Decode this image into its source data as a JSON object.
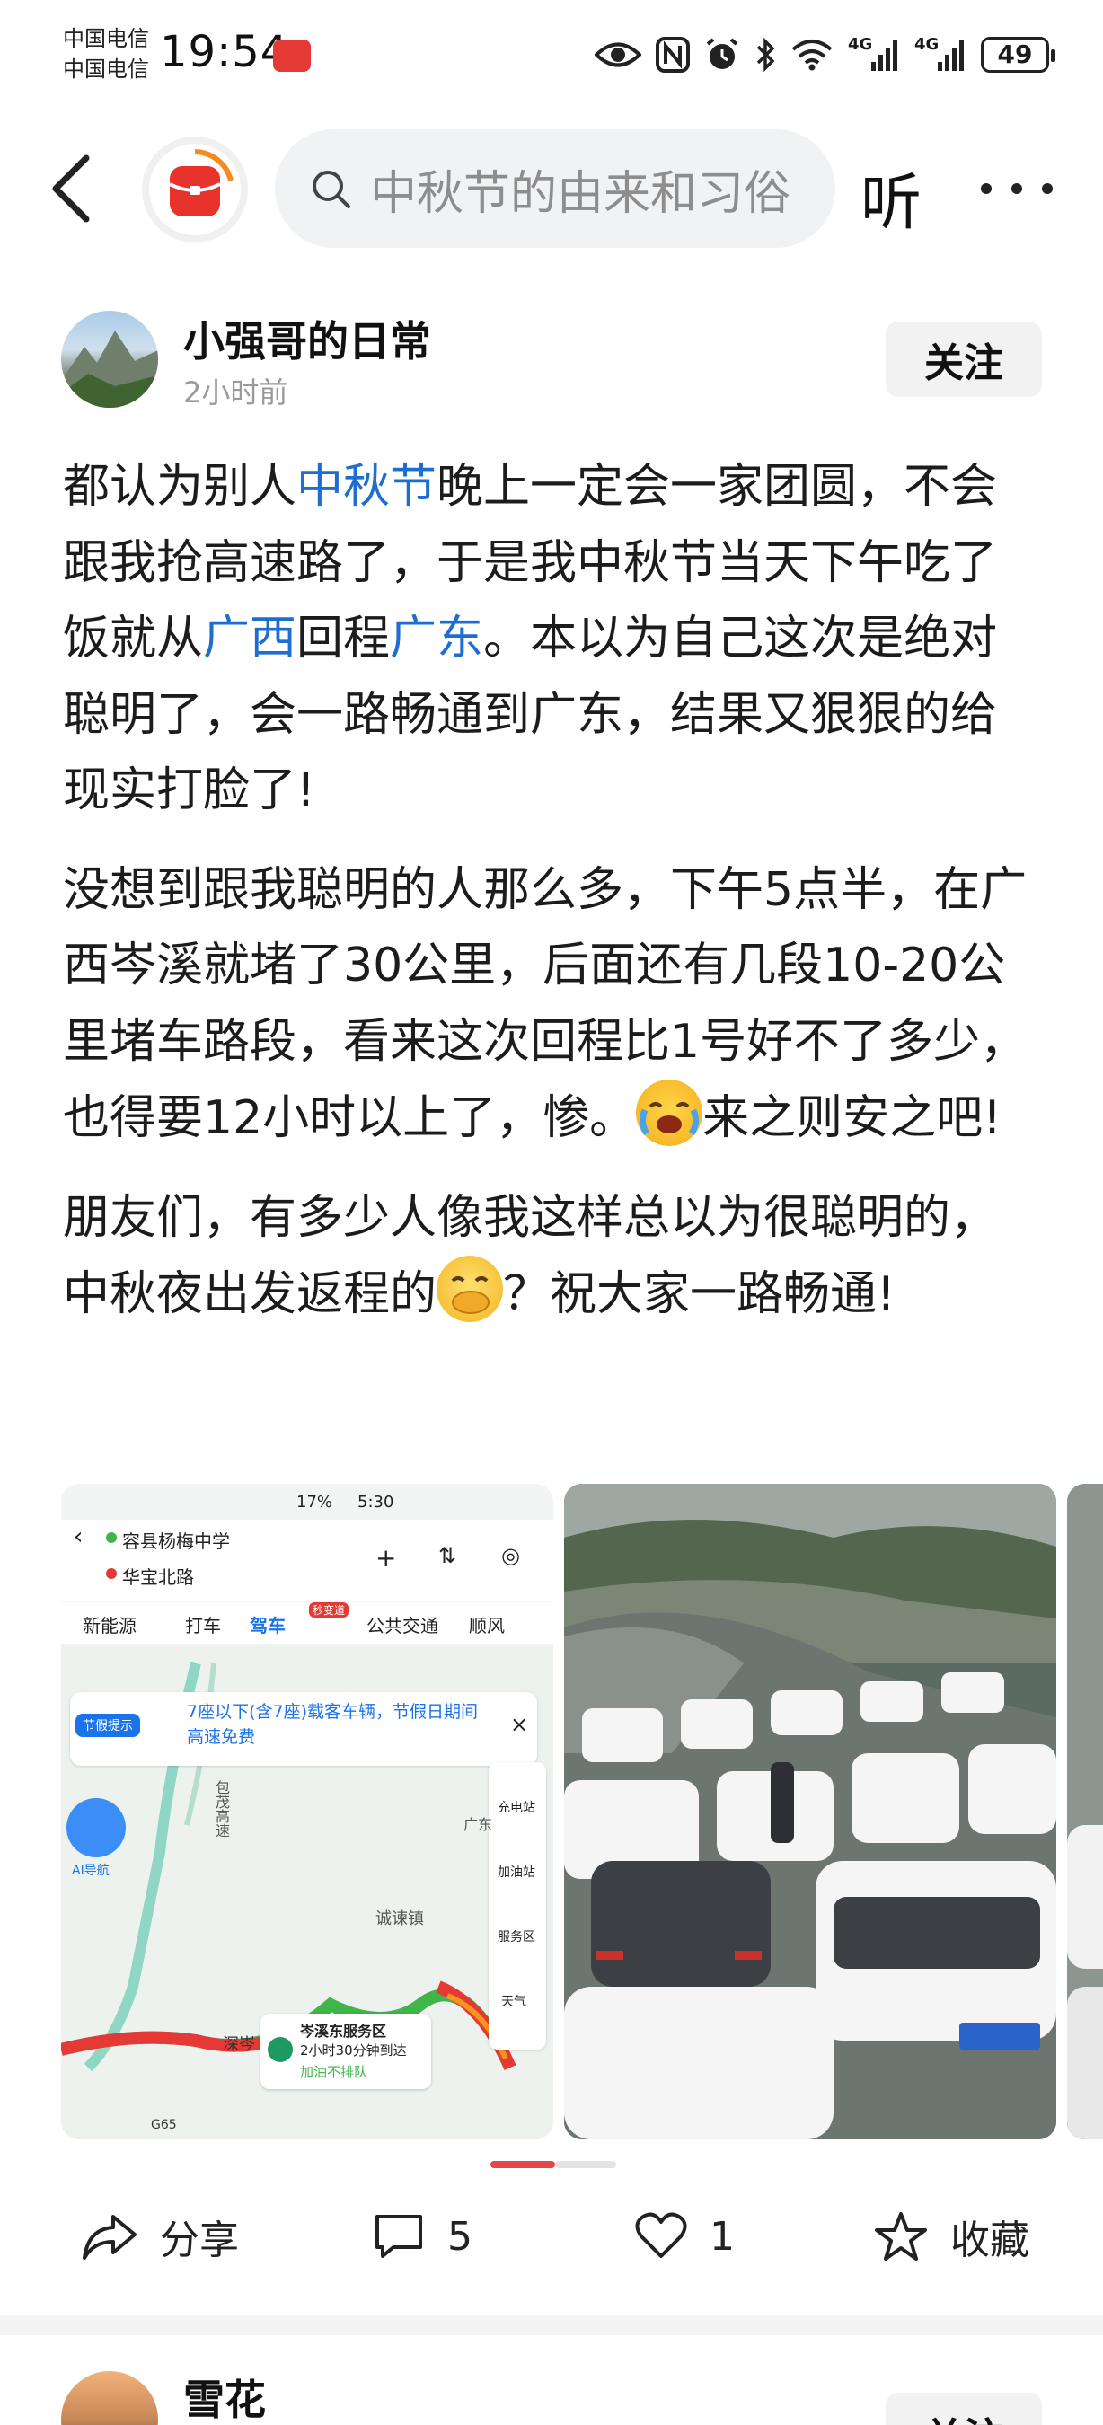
{
  "status_bar": {
    "carrier_1": "中国电信",
    "carrier_2": "中国电信",
    "time": "19:54",
    "network_1": "4G",
    "network_2": "4G",
    "battery": "49"
  },
  "top_nav": {
    "search_placeholder": "中秋节的由来和习俗",
    "listen_label": "听"
  },
  "post": {
    "author_name": "小强哥的日常",
    "time_ago": "2小时前",
    "follow_label": "关注",
    "paragraphs": {
      "p1_a": "都认为别人",
      "p1_link1": "中秋节",
      "p1_b": "晚上一定会一家团圆，不会跟我抢高速路了，于是我中秋节当天下午吃了饭就从",
      "p1_link2": "广西",
      "p1_c": "回程",
      "p1_link3": "广东",
      "p1_d": "。本以为自己这次是绝对聪明了，会一路畅通到广东，结果又狠狠的给现实打脸了!",
      "p2_a": "没想到跟我聪明的人那么多，下午5点半，在广西岑溪就堵了30公里，后面还有几段10-20公里堵车路段，看来这次回程比1号好不了多少，也得要12小时以上了，惨。",
      "p2_b": "来之则安之吧!",
      "p3_a": "朋友们，有多少人像我这样总以为很聪明的，中秋夜出发返程的",
      "p3_b": "？祝大家一路畅通!"
    }
  },
  "map_image": {
    "status_time": "5:30",
    "status_battery": "17%",
    "origin": "容县杨梅中学",
    "destination": "华宝北路",
    "tabs": [
      "新能源",
      "打车",
      "驾车",
      "公共交通",
      "顺风"
    ],
    "drive_badge": "秒变道",
    "notice_tag": "节假提示",
    "notice_text": "7座以下(含7座)载客车辆，节假日期间高速免费",
    "side_tools": [
      "充电站",
      "加油站",
      "服务区",
      "天气"
    ],
    "ai_label": "AI导航",
    "place_1": "诚谏镇",
    "place_2": "广东",
    "road_label": "包茂高速",
    "service_name": "岑溪东服务区",
    "service_eta": "2小时30分钟到达",
    "service_note": "加油不排队",
    "segment_label": "深岑",
    "highway_code": "G65"
  },
  "actions": {
    "share_label": "分享",
    "comment_count": "5",
    "like_count": "1",
    "favorite_label": "收藏"
  },
  "next_post": {
    "author_name": "雪花",
    "follow_label": "关注"
  },
  "colors": {
    "link": "#1e6dd1",
    "accent": "#e5464a",
    "traffic_red": "#e53935",
    "traffic_green": "#3fb54a",
    "map_blue": "#1a73e8"
  }
}
